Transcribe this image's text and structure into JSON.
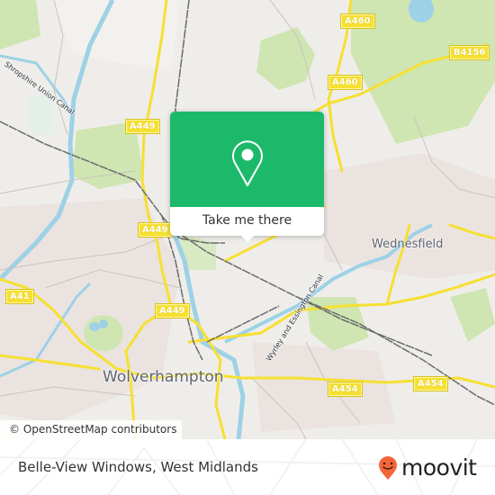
{
  "map": {
    "attribution": "© OpenStreetMap contributors",
    "place_labels": {
      "wolverhampton": "Wolverhampton",
      "wednesfield": "Wednesfield"
    },
    "canal_labels": {
      "shropshire": "Shropshire Union Canal",
      "wyrley": "Wyrley and Essington Canal"
    },
    "road_shields": [
      {
        "id": "a460-top",
        "label": "A460"
      },
      {
        "id": "b4156",
        "label": "B4156"
      },
      {
        "id": "a460-mid",
        "label": "A460"
      },
      {
        "id": "a449-top",
        "label": "A449"
      },
      {
        "id": "a449-mid",
        "label": "A449"
      },
      {
        "id": "a41",
        "label": "A41"
      },
      {
        "id": "a449-low",
        "label": "A449"
      },
      {
        "id": "a454-left",
        "label": "A454"
      },
      {
        "id": "a454-right",
        "label": "A454"
      }
    ],
    "colors": {
      "land": "#efedea",
      "park": "#cfe5b2",
      "water": "#9dd1e6",
      "major_road": "#f6e032",
      "rail": "#6b6b6b"
    }
  },
  "popup": {
    "icon": "map-pin-icon",
    "button_label": "Take me there",
    "accent_color": "#1db96b"
  },
  "footer": {
    "business_name": "Belle-View Windows, West Midlands",
    "brand": "moovit",
    "brand_icon": "moovit-smiley-pin-icon",
    "brand_color": "#f4663a"
  }
}
